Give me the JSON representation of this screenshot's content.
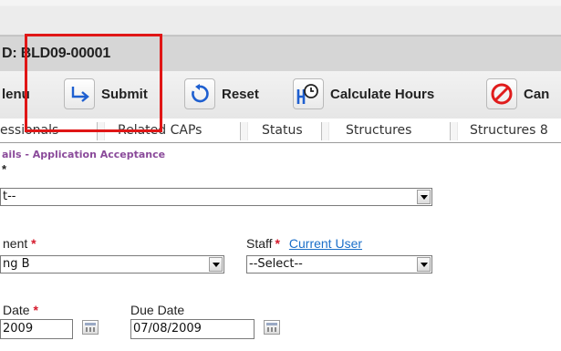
{
  "header": {
    "title": "D: BLD09-00001"
  },
  "toolbar": {
    "menu_label": "lenu",
    "submit_label": "Submit",
    "reset_label": "Reset",
    "calc_label": "Calculate Hours",
    "cancel_label": "Can"
  },
  "tabs": [
    {
      "label": "essionals"
    },
    {
      "label": "Related CAPs"
    },
    {
      "label": "Status"
    },
    {
      "label": "Structures"
    },
    {
      "label": "Structures 8"
    }
  ],
  "form": {
    "section_title": "ails - Application Acceptance",
    "required_mark": "*",
    "select1": {
      "value": "t--"
    },
    "department": {
      "label": "nent",
      "value": "ng B"
    },
    "staff": {
      "label": "Staff",
      "link": "Current User",
      "value": "--Select--"
    },
    "date": {
      "label": "Date",
      "value": "2009"
    },
    "due_date": {
      "label": "Due Date",
      "value": "07/08/2009"
    }
  },
  "colors": {
    "highlight": "#e01616",
    "section_title": "#8a4a9a",
    "required": "#d51a2c",
    "link": "#1b6fc9"
  }
}
